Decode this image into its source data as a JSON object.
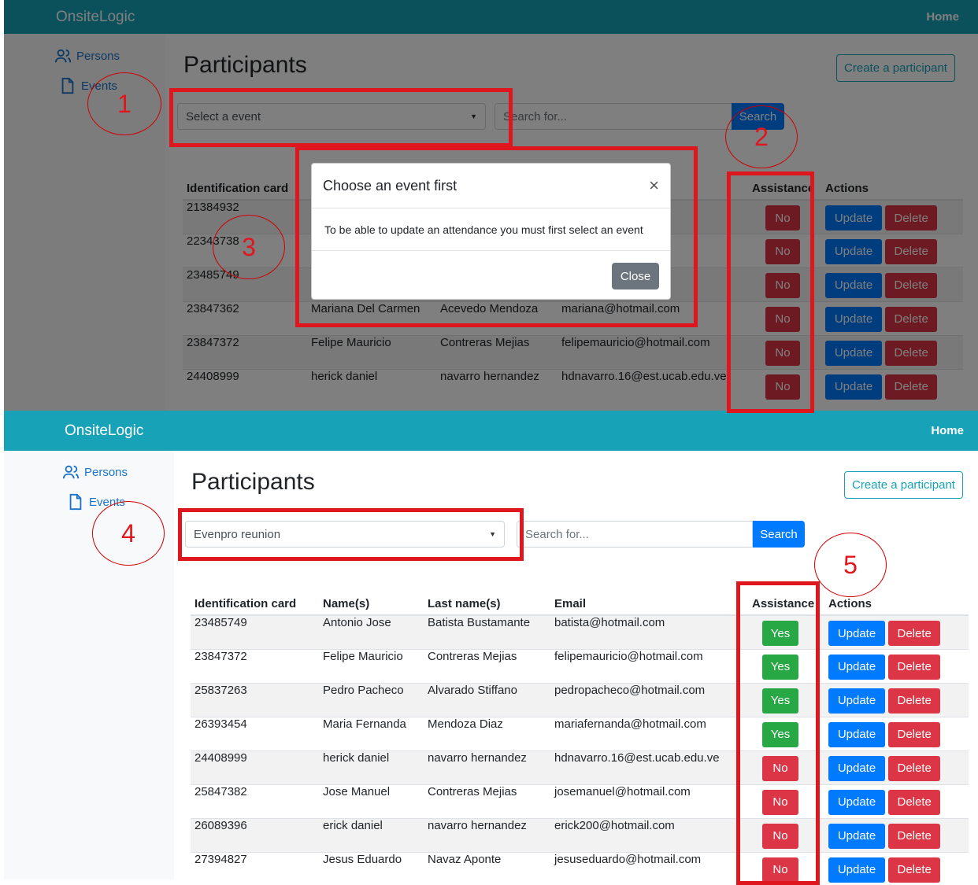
{
  "app": {
    "brand": "OnsiteLogic",
    "home_link": "Home"
  },
  "sidebar": {
    "items": [
      {
        "label": "Persons",
        "icon": "users-icon"
      },
      {
        "label": "Events",
        "icon": "file-icon"
      }
    ]
  },
  "page": {
    "title": "Participants",
    "create_button": "Create a participant",
    "search_placeholder": "Search for...",
    "search_button": "Search"
  },
  "columns": [
    "Identification card",
    "Name(s)",
    "Last name(s)",
    "Email",
    "Assistance",
    "Actions"
  ],
  "actions": {
    "update": "Update",
    "delete": "Delete"
  },
  "top_screen": {
    "event_select": "Select a event",
    "rows": [
      {
        "id": "21384932",
        "name": "",
        "last": "",
        "email": "",
        "assist": "No"
      },
      {
        "id": "22343738",
        "name": "",
        "last": "",
        "email": "",
        "assist": "No"
      },
      {
        "id": "23485749",
        "name": "",
        "last": "",
        "email": "",
        "assist": "No"
      },
      {
        "id": "23847362",
        "name": "Mariana Del Carmen",
        "last": "Acevedo Mendoza",
        "email": "mariana@hotmail.com",
        "assist": "No"
      },
      {
        "id": "23847372",
        "name": "Felipe Mauricio",
        "last": "Contreras Mejias",
        "email": "felipemauricio@hotmail.com",
        "assist": "No"
      },
      {
        "id": "24408999",
        "name": "herick daniel",
        "last": "navarro hernandez",
        "email": "hdnavarro.16@est.ucab.edu.ve",
        "assist": "No"
      }
    ],
    "modal": {
      "title": "Choose an event first",
      "close_x": "×",
      "body": "To be able to update an attendance you must first select an event",
      "close_button": "Close"
    }
  },
  "bottom_screen": {
    "event_select": "Evenpro reunion",
    "rows": [
      {
        "id": "23485749",
        "name": "Antonio Jose",
        "last": "Batista Bustamante",
        "email": "batista@hotmail.com",
        "assist": "Yes"
      },
      {
        "id": "23847372",
        "name": "Felipe Mauricio",
        "last": "Contreras Mejias",
        "email": "felipemauricio@hotmail.com",
        "assist": "Yes"
      },
      {
        "id": "25837263",
        "name": "Pedro Pacheco",
        "last": "Alvarado Stiffano",
        "email": "pedropacheco@hotmail.com",
        "assist": "Yes"
      },
      {
        "id": "26393454",
        "name": "Maria Fernanda",
        "last": "Mendoza Diaz",
        "email": "mariafernanda@hotmail.com",
        "assist": "Yes"
      },
      {
        "id": "24408999",
        "name": "herick daniel",
        "last": "navarro hernandez",
        "email": "hdnavarro.16@est.ucab.edu.ve",
        "assist": "No"
      },
      {
        "id": "25847382",
        "name": "Jose Manuel",
        "last": "Contreras Mejias",
        "email": "josemanuel@hotmail.com",
        "assist": "No"
      },
      {
        "id": "26089396",
        "name": "erick daniel",
        "last": "navarro hernandez",
        "email": "erick200@hotmail.com",
        "assist": "No"
      },
      {
        "id": "27394827",
        "name": "Jesus Eduardo",
        "last": "Navaz Aponte",
        "email": "jesuseduardo@hotmail.com",
        "assist": "No"
      }
    ]
  },
  "annotations": [
    "1",
    "2",
    "3",
    "4",
    "5"
  ],
  "colors": {
    "navbar": "#17a2b8",
    "primary": "#007bff",
    "danger": "#dc3545",
    "success": "#28a745",
    "annotation": "#e0161e"
  }
}
